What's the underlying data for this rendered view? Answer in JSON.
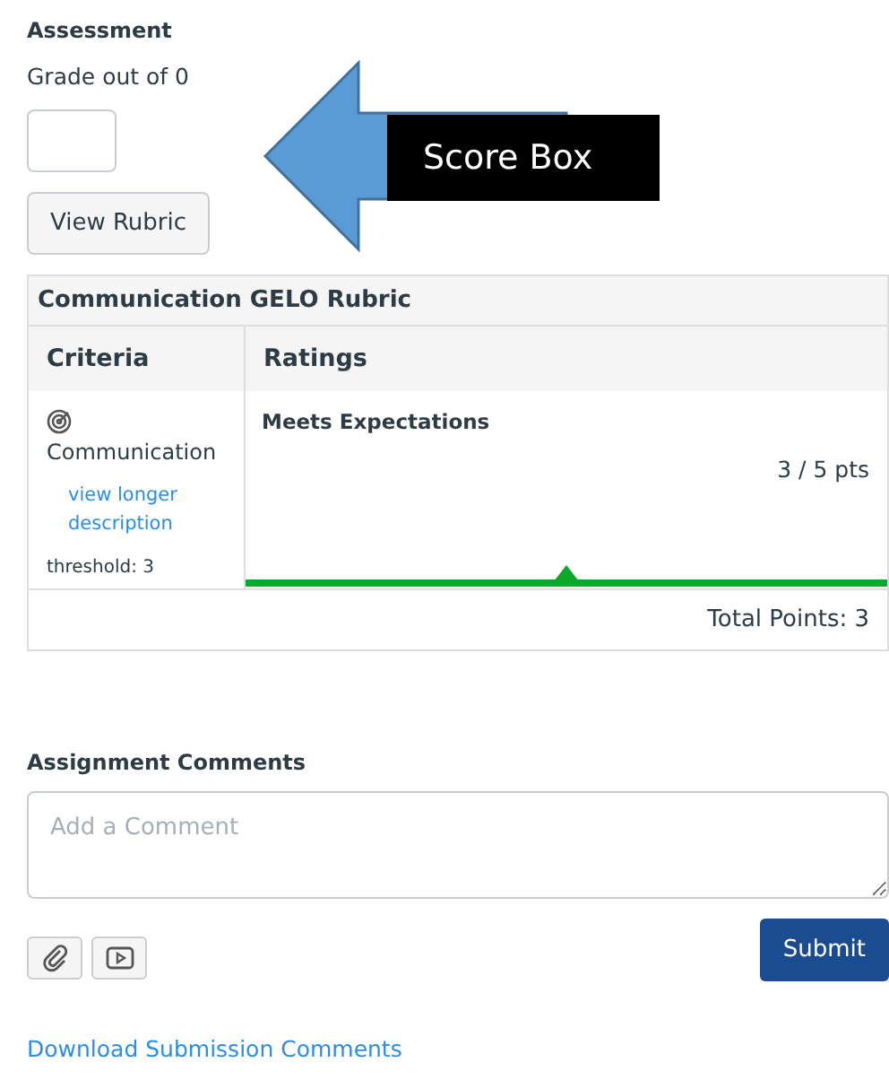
{
  "assessment": {
    "heading": "Assessment",
    "grade_label": "Grade out of 0",
    "view_rubric_button": "View Rubric"
  },
  "annotation": {
    "label": "Score Box"
  },
  "rubric": {
    "title": "Communication GELO Rubric",
    "columns": [
      "Criteria",
      "Ratings"
    ],
    "criteria": [
      {
        "name": "Communication",
        "link": "view longer description",
        "threshold": "threshold: 3",
        "rating": {
          "name": "Meets Expectations",
          "points": "3 / 5 pts",
          "selected": true
        }
      }
    ],
    "total": "Total Points: 3"
  },
  "comments": {
    "heading": "Assignment Comments",
    "placeholder": "Add a Comment",
    "submit_button": "Submit"
  },
  "download_link": "Download Submission Comments"
}
